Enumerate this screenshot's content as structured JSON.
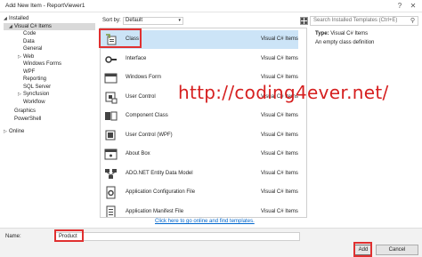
{
  "window": {
    "title": "Add New Item - ReportViewer1",
    "help_glyph": "?",
    "close_glyph": "✕"
  },
  "tree": {
    "items": [
      {
        "label": "Installed",
        "arrow": "◢",
        "level": 0,
        "selected": false
      },
      {
        "label": "Visual C# Items",
        "arrow": "◢",
        "level": 1,
        "selected": true
      },
      {
        "label": "Code",
        "arrow": "",
        "level": 2,
        "selected": false
      },
      {
        "label": "Data",
        "arrow": "",
        "level": 2,
        "selected": false
      },
      {
        "label": "General",
        "arrow": "",
        "level": 2,
        "selected": false
      },
      {
        "label": "Web",
        "arrow": "▷",
        "level": 2,
        "selected": false
      },
      {
        "label": "Windows Forms",
        "arrow": "",
        "level": 2,
        "selected": false
      },
      {
        "label": "WPF",
        "arrow": "",
        "level": 2,
        "selected": false
      },
      {
        "label": "Reporting",
        "arrow": "",
        "level": 2,
        "selected": false
      },
      {
        "label": "SQL Server",
        "arrow": "",
        "level": 2,
        "selected": false
      },
      {
        "label": "Syncfusion",
        "arrow": "▷",
        "level": 2,
        "selected": false
      },
      {
        "label": "Workflow",
        "arrow": "",
        "level": 2,
        "selected": false
      },
      {
        "label": "Graphics",
        "arrow": "",
        "level": 1,
        "selected": false
      },
      {
        "label": "PowerShell",
        "arrow": "",
        "level": 1,
        "selected": false
      },
      {
        "label": "Online",
        "arrow": "▷",
        "level": 0,
        "selected": false
      }
    ]
  },
  "toolbar": {
    "sort_label": "Sort by:",
    "sort_value": "Default",
    "sort_caret": "▾"
  },
  "search": {
    "placeholder": "Search Installed Templates (Ctrl+E)",
    "icon_glyph": "⚲"
  },
  "templates": [
    {
      "name": "Class",
      "lang": "Visual C# Items",
      "icon": "class-icon",
      "selected": true
    },
    {
      "name": "Interface",
      "lang": "Visual C# Items",
      "icon": "interface-icon",
      "selected": false
    },
    {
      "name": "Windows Form",
      "lang": "Visual C# Items",
      "icon": "windows-form-icon",
      "selected": false
    },
    {
      "name": "User Control",
      "lang": "Visual C# Items",
      "icon": "user-control-icon",
      "selected": false
    },
    {
      "name": "Component Class",
      "lang": "Visual C# Items",
      "icon": "component-class-icon",
      "selected": false
    },
    {
      "name": "User Control (WPF)",
      "lang": "Visual C# Items",
      "icon": "user-control-wpf-icon",
      "selected": false
    },
    {
      "name": "About Box",
      "lang": "Visual C# Items",
      "icon": "about-box-icon",
      "selected": false
    },
    {
      "name": "ADO.NET Entity Data Model",
      "lang": "Visual C# Items",
      "icon": "entity-data-model-icon",
      "selected": false
    },
    {
      "name": "Application Configuration File",
      "lang": "Visual C# Items",
      "icon": "config-file-icon",
      "selected": false
    },
    {
      "name": "Application Manifest File",
      "lang": "Visual C# Items",
      "icon": "manifest-file-icon",
      "selected": false
    }
  ],
  "scroll": {
    "up": "▲",
    "down": "▼"
  },
  "online_link": "Click here to go online and find templates.",
  "description": {
    "type_label": "Type:",
    "type_value": "Visual C# Items",
    "text": "An empty class definition"
  },
  "watermark": "http://coding4ever.net/",
  "bottom": {
    "name_label": "Name:",
    "name_value": "Product",
    "add_label": "Add",
    "cancel_label": "Cancel"
  },
  "colors": {
    "highlight_red": "#e03030",
    "selection_blue": "#cce4f7",
    "link_blue": "#0066cc",
    "watermark_red": "#d61f1f"
  }
}
